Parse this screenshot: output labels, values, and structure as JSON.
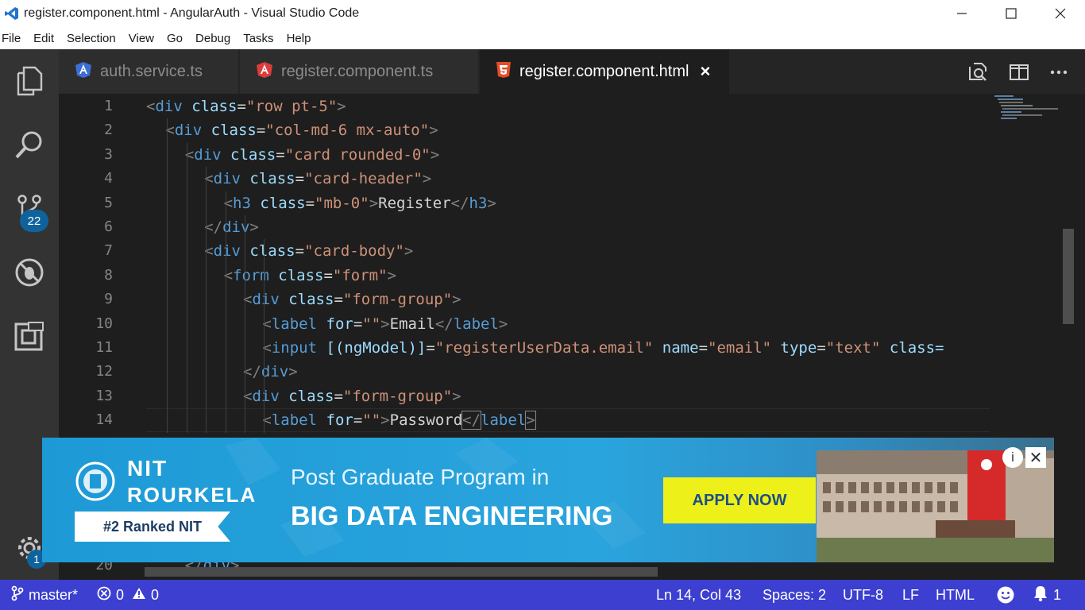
{
  "window": {
    "title": "register.component.html - AngularAuth - Visual Studio Code",
    "controls": [
      "minimize",
      "maximize",
      "close"
    ]
  },
  "menu": [
    "File",
    "Edit",
    "Selection",
    "View",
    "Go",
    "Debug",
    "Tasks",
    "Help"
  ],
  "activity_bar": {
    "icons": [
      "explorer-icon",
      "search-icon",
      "source-control-icon",
      "debug-icon",
      "extensions-icon",
      "gear-icon"
    ],
    "source_control_badge": "22",
    "settings_badge": "1"
  },
  "tabs": [
    {
      "label": "auth.service.ts",
      "icon": "angular-service-icon",
      "active": false
    },
    {
      "label": "register.component.ts",
      "icon": "angular-icon",
      "active": false
    },
    {
      "label": "register.component.html",
      "icon": "html5-icon",
      "active": true,
      "close": "×"
    }
  ],
  "editor": {
    "line_numbers": [
      "1",
      "2",
      "3",
      "4",
      "5",
      "6",
      "7",
      "8",
      "9",
      "10",
      "11",
      "12",
      "13",
      "14",
      "20"
    ],
    "lines": [
      [
        [
          "t-br",
          "<"
        ],
        [
          "t-tag",
          "div"
        ],
        [
          "t-txt",
          " "
        ],
        [
          "t-at",
          "class"
        ],
        [
          "t-txt",
          "="
        ],
        [
          "t-str",
          "\"row pt-5\""
        ],
        [
          "t-br",
          ">"
        ]
      ],
      [
        [
          "t-br",
          "<"
        ],
        [
          "t-tag",
          "div"
        ],
        [
          "t-txt",
          " "
        ],
        [
          "t-at",
          "class"
        ],
        [
          "t-txt",
          "="
        ],
        [
          "t-str",
          "\"col-md-6 mx-auto\""
        ],
        [
          "t-br",
          ">"
        ]
      ],
      [
        [
          "t-br",
          "<"
        ],
        [
          "t-tag",
          "div"
        ],
        [
          "t-txt",
          " "
        ],
        [
          "t-at",
          "class"
        ],
        [
          "t-txt",
          "="
        ],
        [
          "t-str",
          "\"card rounded-0\""
        ],
        [
          "t-br",
          ">"
        ]
      ],
      [
        [
          "t-br",
          "<"
        ],
        [
          "t-tag",
          "div"
        ],
        [
          "t-txt",
          " "
        ],
        [
          "t-at",
          "class"
        ],
        [
          "t-txt",
          "="
        ],
        [
          "t-str",
          "\"card-header\""
        ],
        [
          "t-br",
          ">"
        ]
      ],
      [
        [
          "t-br",
          "<"
        ],
        [
          "t-tag",
          "h3"
        ],
        [
          "t-txt",
          " "
        ],
        [
          "t-at",
          "class"
        ],
        [
          "t-txt",
          "="
        ],
        [
          "t-str",
          "\"mb-0\""
        ],
        [
          "t-br",
          ">"
        ],
        [
          "t-txt",
          "Register"
        ],
        [
          "t-br",
          "</"
        ],
        [
          "t-tag",
          "h3"
        ],
        [
          "t-br",
          ">"
        ]
      ],
      [
        [
          "t-br",
          "</"
        ],
        [
          "t-tag",
          "div"
        ],
        [
          "t-br",
          ">"
        ]
      ],
      [
        [
          "t-br",
          "<"
        ],
        [
          "t-tag",
          "div"
        ],
        [
          "t-txt",
          " "
        ],
        [
          "t-at",
          "class"
        ],
        [
          "t-txt",
          "="
        ],
        [
          "t-str",
          "\"card-body\""
        ],
        [
          "t-br",
          ">"
        ]
      ],
      [
        [
          "t-br",
          "<"
        ],
        [
          "t-tag",
          "form"
        ],
        [
          "t-txt",
          " "
        ],
        [
          "t-at",
          "class"
        ],
        [
          "t-txt",
          "="
        ],
        [
          "t-str",
          "\"form\""
        ],
        [
          "t-br",
          ">"
        ]
      ],
      [
        [
          "t-br",
          "<"
        ],
        [
          "t-tag",
          "div"
        ],
        [
          "t-txt",
          " "
        ],
        [
          "t-at",
          "class"
        ],
        [
          "t-txt",
          "="
        ],
        [
          "t-str",
          "\"form-group\""
        ],
        [
          "t-br",
          ">"
        ]
      ],
      [
        [
          "t-br",
          "<"
        ],
        [
          "t-tag",
          "label"
        ],
        [
          "t-txt",
          " "
        ],
        [
          "t-at",
          "for"
        ],
        [
          "t-txt",
          "="
        ],
        [
          "t-str",
          "\"\""
        ],
        [
          "t-br",
          ">"
        ],
        [
          "t-txt",
          "Email"
        ],
        [
          "t-br",
          "</"
        ],
        [
          "t-tag",
          "label"
        ],
        [
          "t-br",
          ">"
        ]
      ],
      [
        [
          "t-br",
          "<"
        ],
        [
          "t-tag",
          "input"
        ],
        [
          "t-txt",
          " "
        ],
        [
          "t-at",
          "[(ngModel)]"
        ],
        [
          "t-txt",
          "="
        ],
        [
          "t-str",
          "\"registerUserData.email\""
        ],
        [
          "t-txt",
          " "
        ],
        [
          "t-at",
          "name"
        ],
        [
          "t-txt",
          "="
        ],
        [
          "t-str",
          "\"email\""
        ],
        [
          "t-txt",
          " "
        ],
        [
          "t-at",
          "type"
        ],
        [
          "t-txt",
          "="
        ],
        [
          "t-str",
          "\"text\""
        ],
        [
          "t-txt",
          " "
        ],
        [
          "t-at",
          "class="
        ]
      ],
      [
        [
          "t-br",
          "</"
        ],
        [
          "t-tag",
          "div"
        ],
        [
          "t-br",
          ">"
        ]
      ],
      [
        [
          "t-br",
          "<"
        ],
        [
          "t-tag",
          "div"
        ],
        [
          "t-txt",
          " "
        ],
        [
          "t-at",
          "class"
        ],
        [
          "t-txt",
          "="
        ],
        [
          "t-str",
          "\"form-group\""
        ],
        [
          "t-br",
          ">"
        ]
      ],
      [
        [
          "t-br",
          "<"
        ],
        [
          "t-tag",
          "label"
        ],
        [
          "t-txt",
          " "
        ],
        [
          "t-at",
          "for"
        ],
        [
          "t-txt",
          "="
        ],
        [
          "t-str",
          "\"\""
        ],
        [
          "t-br",
          ">"
        ],
        [
          "t-txt",
          "Password"
        ],
        [
          "t-br",
          "</"
        ],
        [
          "t-tag",
          "label"
        ],
        [
          "t-br",
          ">"
        ]
      ],
      [
        [
          "t-br",
          "</"
        ],
        [
          "t-tag",
          "div"
        ],
        [
          "t-br",
          ">"
        ]
      ]
    ]
  },
  "status": {
    "branch": "master*",
    "errors": "0",
    "warnings": "0",
    "position": "Ln 14, Col 43",
    "spaces": "Spaces: 2",
    "encoding": "UTF-8",
    "eol": "LF",
    "language": "HTML",
    "notifications": "1"
  },
  "ad": {
    "institute_line1": "NIT",
    "institute_line2": "ROURKELA",
    "rank": "#2 Ranked NIT",
    "headline1": "Post Graduate Program in",
    "headline2": "BIG DATA ENGINEERING",
    "cta": "APPLY NOW",
    "info": "i",
    "close": "✕",
    "colors": {
      "background": "#1d9ad6",
      "cta_background": "#eef01a",
      "cta_text": "#1d4f86"
    }
  },
  "colors": {
    "status_bar": "#3c3fcf",
    "activity_bar": "#333333",
    "editor_bg": "#1e1e1e",
    "tag": "#569cd6",
    "attribute": "#9cdcfe",
    "string": "#ce9178"
  }
}
